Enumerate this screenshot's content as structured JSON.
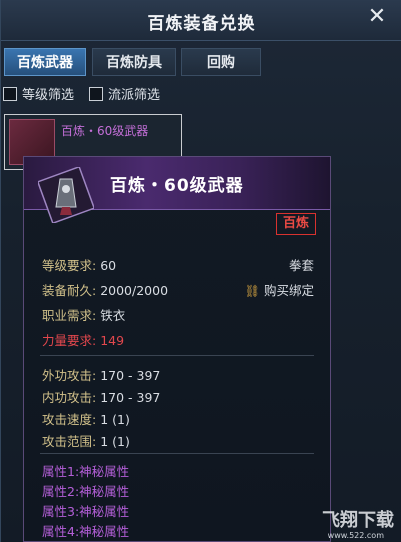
{
  "window": {
    "title": "百炼装备兑换"
  },
  "tabs": [
    {
      "label": "百炼武器",
      "active": true
    },
    {
      "label": "百炼防具",
      "active": false
    },
    {
      "label": "回购",
      "active": false
    }
  ],
  "filters": [
    {
      "label": "等级筛选",
      "checked": false
    },
    {
      "label": "流派筛选",
      "checked": false
    }
  ],
  "list": {
    "items": [
      {
        "name": "百炼・60级武器"
      }
    ]
  },
  "tooltip": {
    "name": "百炼・60级武器",
    "grade": "百炼",
    "level_label": "等级要求:",
    "level_value": "60",
    "weapon_type": "拳套",
    "durability_label": "装备耐久:",
    "durability_value": "2000/2000",
    "bind_text": "购买绑定",
    "class_label": "职业需求:",
    "class_value": "铁衣",
    "strength_label": "力量要求:",
    "strength_value": "149",
    "outer_atk_label": "外功攻击:",
    "outer_atk_value": "170 - 397",
    "inner_atk_label": "内功攻击:",
    "inner_atk_value": "170 - 397",
    "speed_label": "攻击速度:",
    "speed_value": "1 (1)",
    "range_label": "攻击范围:",
    "range_value": "1 (1)",
    "attributes": [
      "属性1:神秘属性",
      "属性2:神秘属性",
      "属性3:神秘属性",
      "属性4:神秘属性"
    ]
  },
  "watermark": {
    "text": "飞翔下载",
    "url": "www.522.com"
  },
  "colors": {
    "accent": "#3a75b0",
    "grade_red": "#e2474d",
    "attr_purple": "#b45fd8",
    "label_gold": "#d1c08a"
  }
}
